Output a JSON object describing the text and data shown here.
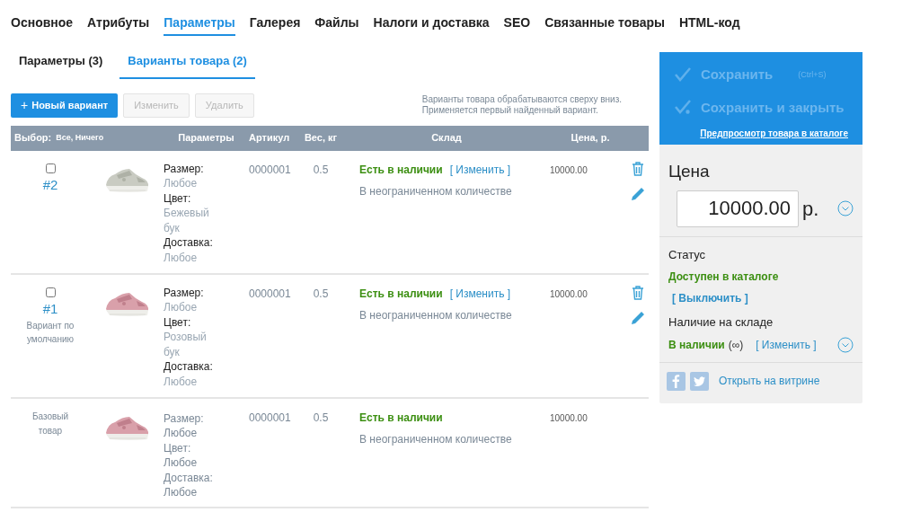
{
  "main_tabs": [
    {
      "label": "Основное",
      "selected": false
    },
    {
      "label": "Атрибуты",
      "selected": false
    },
    {
      "label": "Параметры",
      "selected": true
    },
    {
      "label": "Галерея",
      "selected": false
    },
    {
      "label": "Файлы",
      "selected": false
    },
    {
      "label": "Налоги и доставка",
      "selected": false
    },
    {
      "label": "SEO",
      "selected": false
    },
    {
      "label": "Связанные товары",
      "selected": false
    },
    {
      "label": "HTML-код",
      "selected": false
    }
  ],
  "sub_tabs": [
    {
      "label": "Параметры (3)",
      "selected": false
    },
    {
      "label": "Варианты товара (2)",
      "selected": true
    }
  ],
  "toolbar": {
    "buttons": [
      {
        "label": "Новый вариант",
        "icon": "+",
        "disabled": false
      },
      {
        "label": "Изменить",
        "disabled": true
      },
      {
        "label": "Удалить",
        "disabled": true
      }
    ],
    "hint": [
      "Варианты товара обрабатываются сверху вниз.",
      "Применяется первый найденный вариант."
    ]
  },
  "table": {
    "select_label": "Выбор:",
    "select_links": "Все, Ничего",
    "columns": [
      "Параметры",
      "Артикул",
      "Вес, кг",
      "Склад",
      "Цена, р."
    ],
    "rows": [
      {
        "kind": "variant",
        "checked": false,
        "number": "#2",
        "params": [
          {
            "label": "Размер:",
            "value": "Любое"
          },
          {
            "label": "Цвет:",
            "value": "Бежевый бук"
          },
          {
            "label": "Доставка:",
            "value": "Любое"
          }
        ],
        "sku": "0000001",
        "weight": "0.5",
        "stock": "Есть в наличии",
        "stock_link": "[ Изменить ]",
        "stock_note": "В неограниченном количестве",
        "price": "10000.00"
      },
      {
        "kind": "variant",
        "checked": false,
        "number": "#1",
        "note": "Вариант по умолчанию",
        "params": [
          {
            "label": "Размер:",
            "value": "Любое"
          },
          {
            "label": "Цвет:",
            "value": "Розовый бук"
          },
          {
            "label": "Доставка:",
            "value": "Любое"
          }
        ],
        "sku": "0000001",
        "weight": "0.5",
        "stock": "Есть в наличии",
        "stock_link": "[ Изменить ]",
        "stock_note": "В неограниченном количестве",
        "price": "10000.00"
      },
      {
        "kind": "base",
        "label": "Базовый товар",
        "params": [
          {
            "label": "Размер:",
            "value": "Любое"
          },
          {
            "label": "Цвет:",
            "value": "Любое"
          },
          {
            "label": "Доставка:",
            "value": "Любое"
          }
        ],
        "sku": "0000001",
        "weight": "0.5",
        "stock": "Есть в наличии",
        "stock_note": "В неограниченном количестве",
        "price": "10000.00"
      }
    ]
  },
  "side": {
    "save": "Сохранить",
    "shortcut": "(Ctrl+S)",
    "save_close": "Сохранить и закрыть",
    "preview": "Предпросмотр товара в каталоге",
    "price_title": "Цена",
    "price": "10000.00",
    "currency": "р.",
    "status_title": "Статус",
    "status": "Доступен в каталоге",
    "status_link": "[ Выключить ]",
    "stock_title": "Наличие на складе",
    "stock": "В наличии",
    "stock_extra": "(∞)",
    "stock_link": "[ Изменить ]",
    "open_link": "Открыть на витрине"
  }
}
